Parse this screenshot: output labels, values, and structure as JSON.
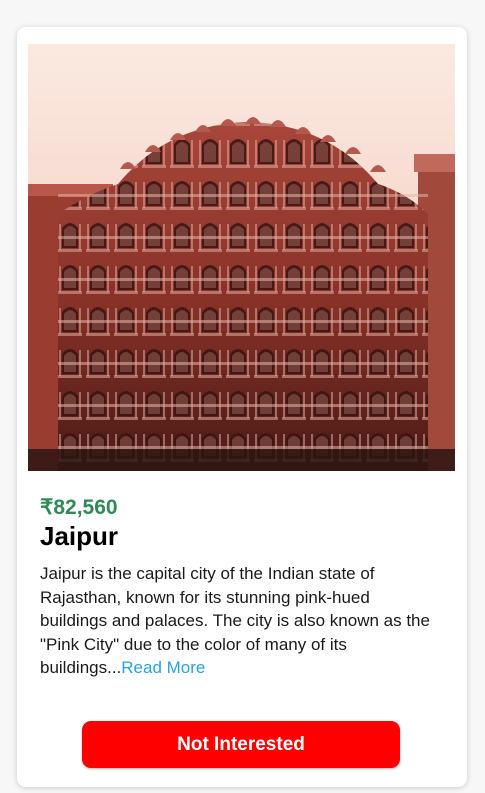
{
  "card": {
    "price": "₹82,560",
    "title": "Jaipur",
    "description": "Jaipur is the capital city of the Indian state of Rajasthan, known for its stunning pink-hued buildings and palaces. The city is also known as the \"Pink City\" due to the color of many of its buildings...",
    "read_more_label": "Read More",
    "image_subject": "hawa-mahal-palace-photo",
    "not_interested_label": "Not Interested"
  },
  "colors": {
    "price": "#2e8b57",
    "link": "#29a3d8",
    "button": "#ff0000",
    "building": "#8a3228"
  }
}
